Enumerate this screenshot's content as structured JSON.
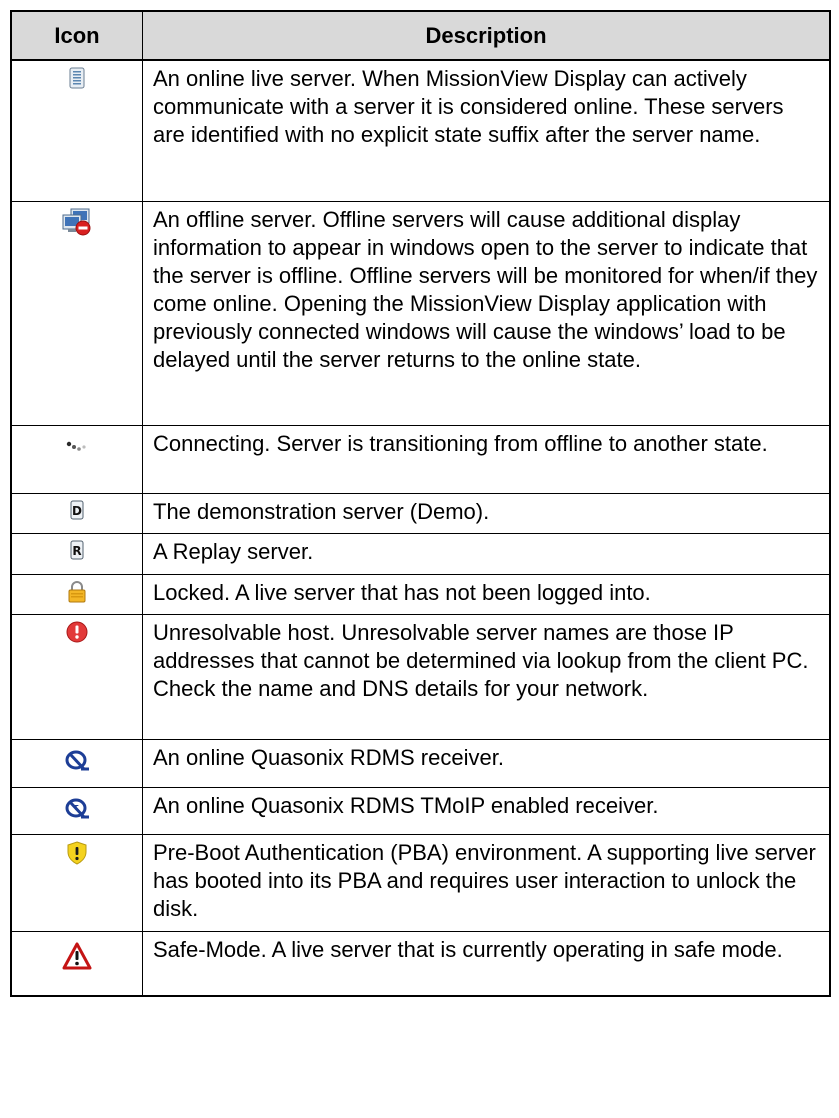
{
  "table": {
    "header_icon": "Icon",
    "header_description": "Description",
    "rows": [
      {
        "icon": "online-server-icon",
        "description": "An online live server. When MissionView Display can actively communicate with a server it is considered online. These servers are identified with no explicit state suffix after the server name."
      },
      {
        "icon": "offline-server-icon",
        "description": "An offline server. Offline servers will cause additional display information to appear in windows open to the server to indicate that the server is offline. Offline servers will be monitored for when/if they come online. Opening the MissionView Display application with previously connected windows will cause the windows’ load to be delayed until the server returns to the online state."
      },
      {
        "icon": "connecting-icon",
        "description": "Connecting. Server is transitioning from offline to another state."
      },
      {
        "icon": "demo-server-icon",
        "description": "The demonstration server (Demo)."
      },
      {
        "icon": "replay-server-icon",
        "description": "A Replay server."
      },
      {
        "icon": "lock-icon",
        "description": "Locked. A live server that has not been logged into."
      },
      {
        "icon": "error-icon",
        "description": "Unresolvable host. Unresolvable server names are those IP addresses that cannot be determined via lookup from the client PC. Check the name and DNS details for your network."
      },
      {
        "icon": "rdms-receiver-icon",
        "description": "An online Quasonix RDMS receiver."
      },
      {
        "icon": "rdms-tmoip-receiver-icon",
        "description": "An online Quasonix RDMS TMoIP enabled receiver."
      },
      {
        "icon": "shield-warning-icon",
        "description": "Pre-Boot Authentication (PBA) environment. A supporting live server has booted into its PBA and requires user interaction to unlock the disk."
      },
      {
        "icon": "warning-triangle-icon",
        "description": "Safe-Mode. A live server that is currently operating in safe mode."
      }
    ]
  }
}
